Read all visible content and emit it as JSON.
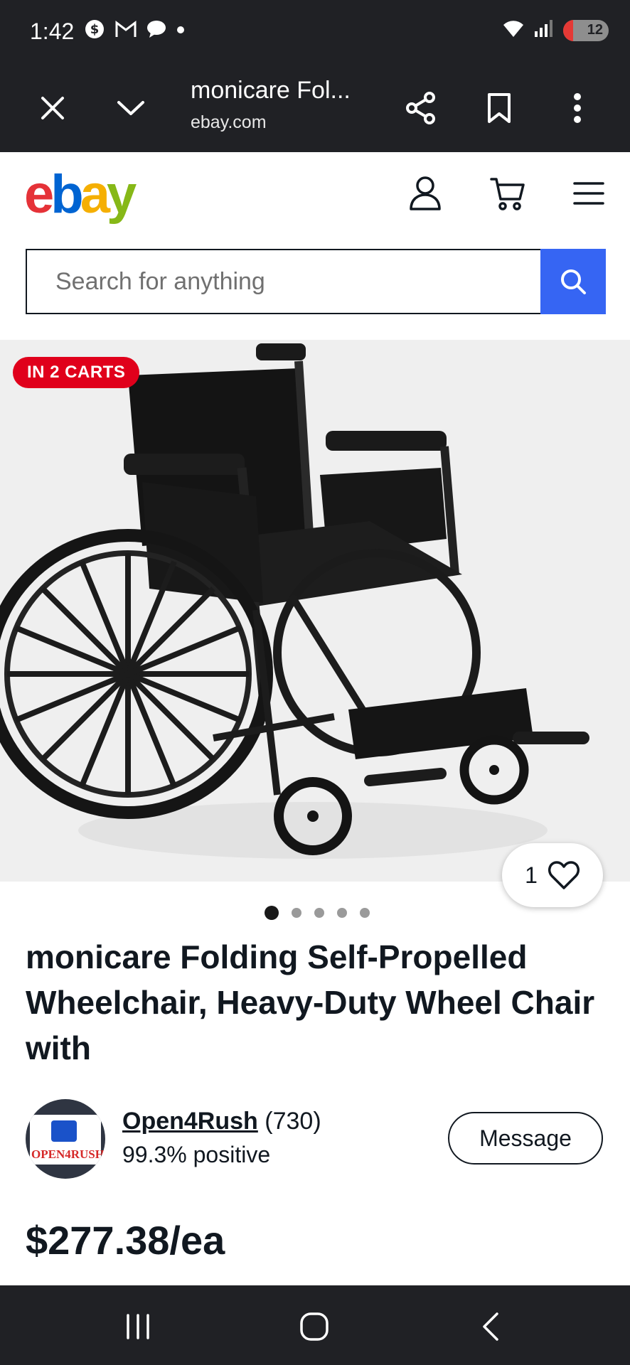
{
  "status_bar": {
    "time": "1:42",
    "battery": "12"
  },
  "browser": {
    "page_title": "monicare Fol...",
    "url": "ebay.com"
  },
  "header": {
    "logo": [
      "e",
      "b",
      "a",
      "y"
    ],
    "colors": {
      "e": "#e53238",
      "b": "#0064d2",
      "a": "#f5af02",
      "y": "#86b817"
    }
  },
  "search": {
    "placeholder": "Search for anything",
    "button_color": "#3665f3"
  },
  "gallery": {
    "badge": "IN 2 CARTS",
    "watch_count": "1",
    "total_images": 5,
    "active_image": 1
  },
  "product": {
    "title": "monicare Folding Self-Propelled Wheelchair, Heavy-Duty Wheel Chair with",
    "price": "$277.38/ea"
  },
  "seller": {
    "name": "Open4Rush",
    "count": "(730)",
    "feedback": "99.3% positive",
    "avatar_text": "OPEN4RUSH",
    "message_label": "Message"
  },
  "icons": {
    "status": [
      "dollar-icon",
      "gmail-icon",
      "chat-icon",
      "dot-icon",
      "wifi-icon",
      "signal-icon",
      "battery-icon"
    ],
    "browser": [
      "close-icon",
      "chevron-down-icon",
      "share-icon",
      "bookmark-icon",
      "more-vert-icon"
    ],
    "header": [
      "account-icon",
      "cart-icon",
      "menu-icon"
    ],
    "nav": [
      "recent-apps-icon",
      "home-icon",
      "back-icon"
    ]
  }
}
